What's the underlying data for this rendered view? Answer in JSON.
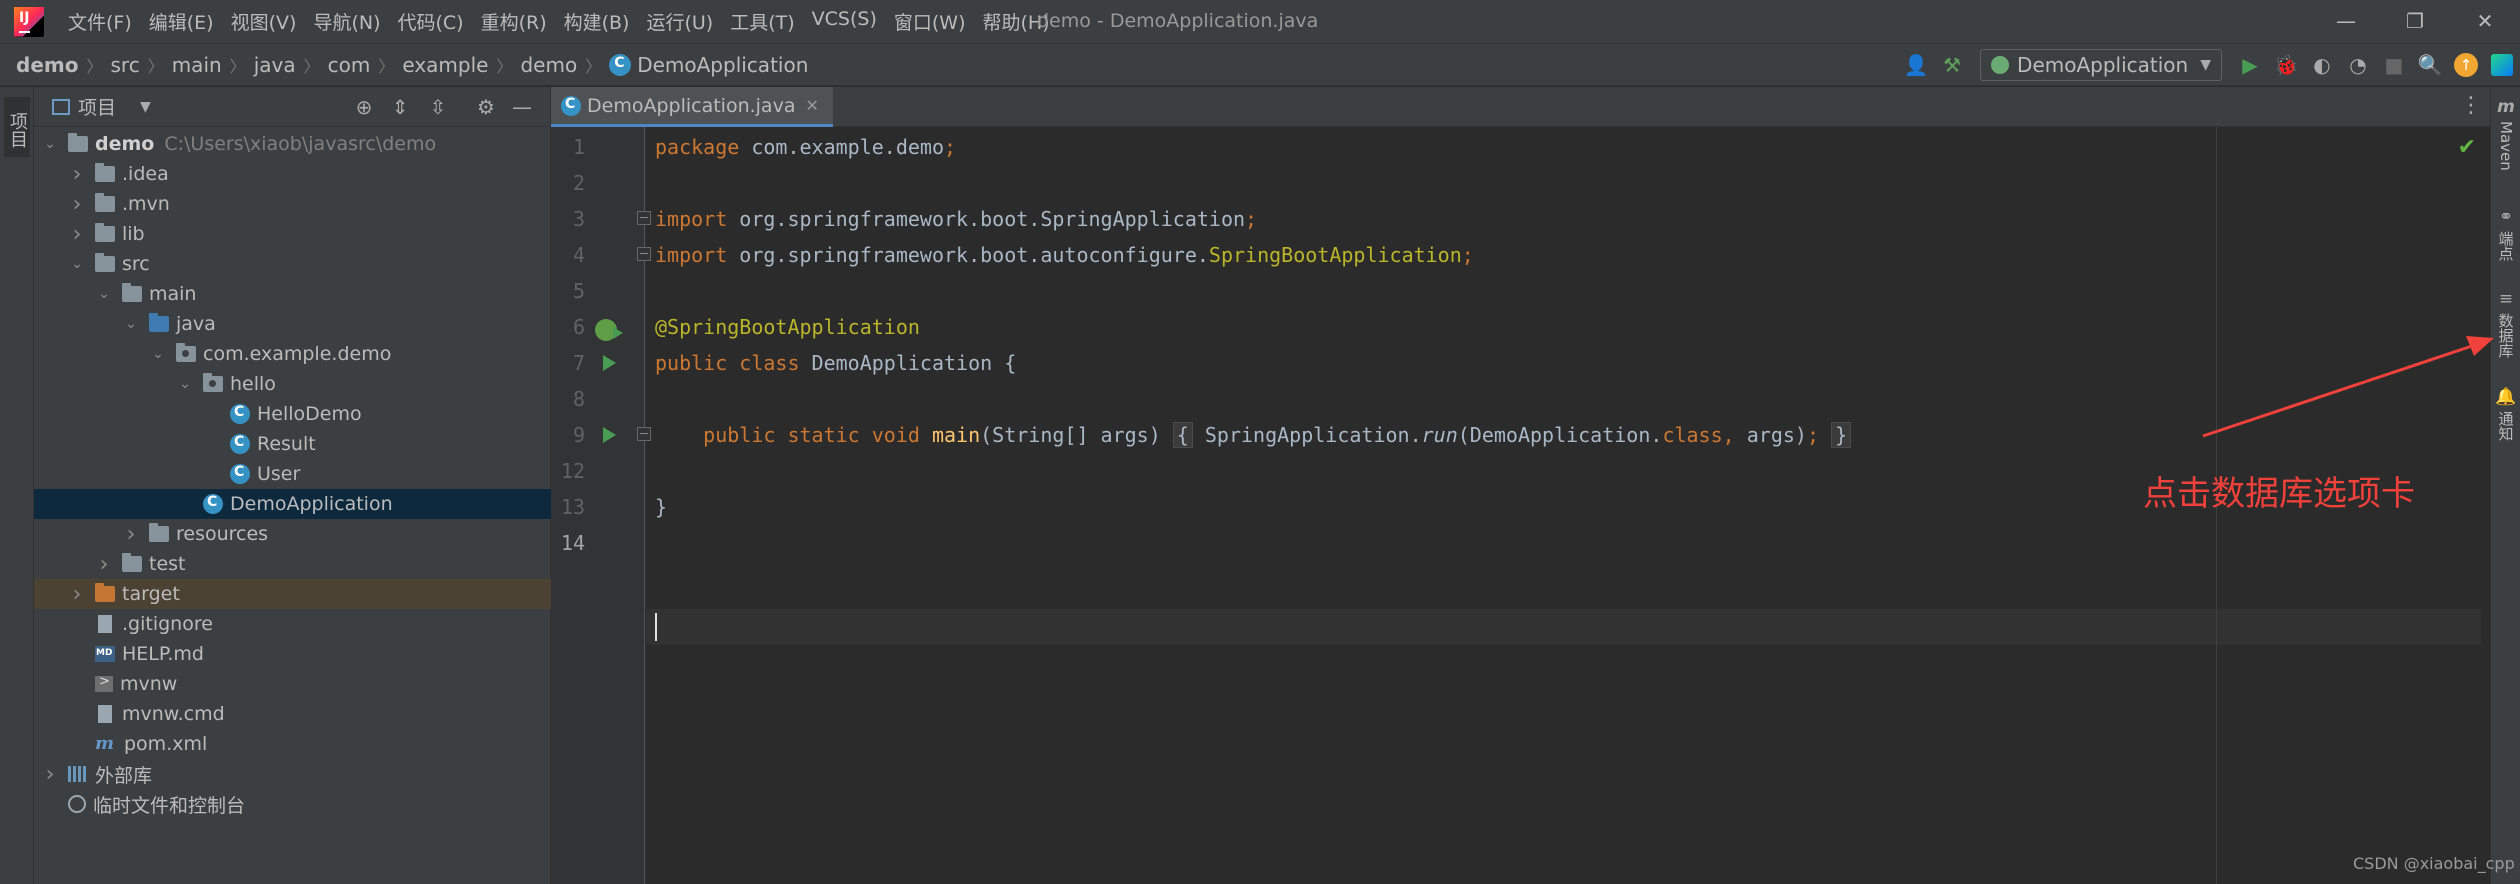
{
  "window": {
    "title": "demo - DemoApplication.java",
    "controls": [
      "—",
      "❐",
      "✕"
    ]
  },
  "menu": [
    "文件(F)",
    "编辑(E)",
    "视图(V)",
    "导航(N)",
    "代码(C)",
    "重构(R)",
    "构建(B)",
    "运行(U)",
    "工具(T)",
    "VCS(S)",
    "窗口(W)",
    "帮助(H)"
  ],
  "breadcrumb": [
    "demo",
    "src",
    "main",
    "java",
    "com",
    "example",
    "demo",
    "DemoApplication"
  ],
  "run_config": "DemoApplication",
  "project_panel": {
    "title": "项目",
    "tree": [
      {
        "label": "demo",
        "path": "C:\\Users\\xiaob\\javasrc\\demo",
        "depth": 0,
        "arrow": "open",
        "icon": "folder",
        "bold": true
      },
      {
        "label": ".idea",
        "depth": 1,
        "arrow": "closed",
        "icon": "folder"
      },
      {
        "label": ".mvn",
        "depth": 1,
        "arrow": "closed",
        "icon": "folder"
      },
      {
        "label": "lib",
        "depth": 1,
        "arrow": "closed",
        "icon": "folder"
      },
      {
        "label": "src",
        "depth": 1,
        "arrow": "open",
        "icon": "folder"
      },
      {
        "label": "main",
        "depth": 2,
        "arrow": "open",
        "icon": "folder"
      },
      {
        "label": "java",
        "depth": 3,
        "arrow": "open",
        "icon": "folder-blue"
      },
      {
        "label": "com.example.demo",
        "depth": 4,
        "arrow": "open",
        "icon": "package"
      },
      {
        "label": "hello",
        "depth": 5,
        "arrow": "open",
        "icon": "package"
      },
      {
        "label": "HelloDemo",
        "depth": 6,
        "arrow": "none",
        "icon": "class"
      },
      {
        "label": "Result",
        "depth": 6,
        "arrow": "none",
        "icon": "class"
      },
      {
        "label": "User",
        "depth": 6,
        "arrow": "none",
        "icon": "class"
      },
      {
        "label": "DemoApplication",
        "depth": 5,
        "arrow": "none",
        "icon": "class",
        "selected": true
      },
      {
        "label": "resources",
        "depth": 3,
        "arrow": "closed",
        "icon": "folder"
      },
      {
        "label": "test",
        "depth": 2,
        "arrow": "closed",
        "icon": "folder"
      },
      {
        "label": "target",
        "depth": 1,
        "arrow": "closed",
        "icon": "folder-orange",
        "excluded": true
      },
      {
        "label": ".gitignore",
        "depth": 1,
        "arrow": "none",
        "icon": "file"
      },
      {
        "label": "HELP.md",
        "depth": 1,
        "arrow": "none",
        "icon": "markdown"
      },
      {
        "label": "mvnw",
        "depth": 1,
        "arrow": "none",
        "icon": "terminal"
      },
      {
        "label": "mvnw.cmd",
        "depth": 1,
        "arrow": "none",
        "icon": "file"
      },
      {
        "label": "pom.xml",
        "depth": 1,
        "arrow": "none",
        "icon": "maven"
      },
      {
        "label": "外部库",
        "depth": 0,
        "arrow": "closed",
        "icon": "library"
      },
      {
        "label": "临时文件和控制台",
        "depth": 0,
        "arrow": "none",
        "icon": "scratch"
      }
    ]
  },
  "editor": {
    "tab_label": "DemoApplication.java",
    "line_numbers": [
      "1",
      "2",
      "3",
      "4",
      "5",
      "6",
      "7",
      "8",
      "9",
      "12",
      "13",
      "14"
    ],
    "lines": [
      [
        {
          "t": "package ",
          "c": "kw"
        },
        {
          "t": "com.example.demo",
          "c": ""
        },
        {
          "t": ";",
          "c": "kw"
        }
      ],
      [],
      [
        {
          "t": "import ",
          "c": "kw"
        },
        {
          "t": "org.springframework.boot.SpringApplication",
          "c": ""
        },
        {
          "t": ";",
          "c": "kw"
        }
      ],
      [
        {
          "t": "import ",
          "c": "kw"
        },
        {
          "t": "org.springframework.boot.autoconfigure.",
          "c": ""
        },
        {
          "t": "SpringBootApplication",
          "c": "ann"
        },
        {
          "t": ";",
          "c": "kw"
        }
      ],
      [],
      [
        {
          "t": "@SpringBootApplication",
          "c": "ann"
        }
      ],
      [
        {
          "t": "public class ",
          "c": "kw"
        },
        {
          "t": "DemoApplication {",
          "c": ""
        }
      ],
      [],
      [
        {
          "t": "    public static void ",
          "c": "kw"
        },
        {
          "t": "main",
          "c": "fn"
        },
        {
          "t": "(String[] args) ",
          "c": ""
        },
        {
          "t": "{",
          "c": "fold-chunk"
        },
        {
          "t": " SpringApplication.",
          "c": ""
        },
        {
          "t": "run",
          "c": "it"
        },
        {
          "t": "(DemoApplication.",
          "c": ""
        },
        {
          "t": "class",
          "c": "kw"
        },
        {
          "t": ", ",
          "c": "kw"
        },
        {
          "t": "args)",
          "c": ""
        },
        {
          "t": ";",
          "c": "kw"
        },
        {
          "t": " ",
          "c": ""
        },
        {
          "t": "}",
          "c": "fold-chunk"
        }
      ],
      [],
      [
        {
          "t": "}",
          "c": ""
        }
      ],
      []
    ]
  },
  "right_tabs": [
    {
      "icon": "m",
      "label": "Maven"
    },
    {
      "icon": "⚭",
      "label": "端点"
    },
    {
      "icon": "≡",
      "label": "数据库"
    },
    {
      "icon": "🔔",
      "label": "通知"
    }
  ],
  "annotation": {
    "text": "点击数据库选项卡",
    "color": "#f0413b"
  },
  "watermark": "CSDN @xiaobai_cpp",
  "colors": {
    "background": "#2b2b2b",
    "panel": "#3c3f41",
    "selection": "#0d293e",
    "keyword": "#cc7832",
    "annotation": "#bbb529",
    "method": "#ffc66d",
    "accent": "#4a88c7"
  }
}
